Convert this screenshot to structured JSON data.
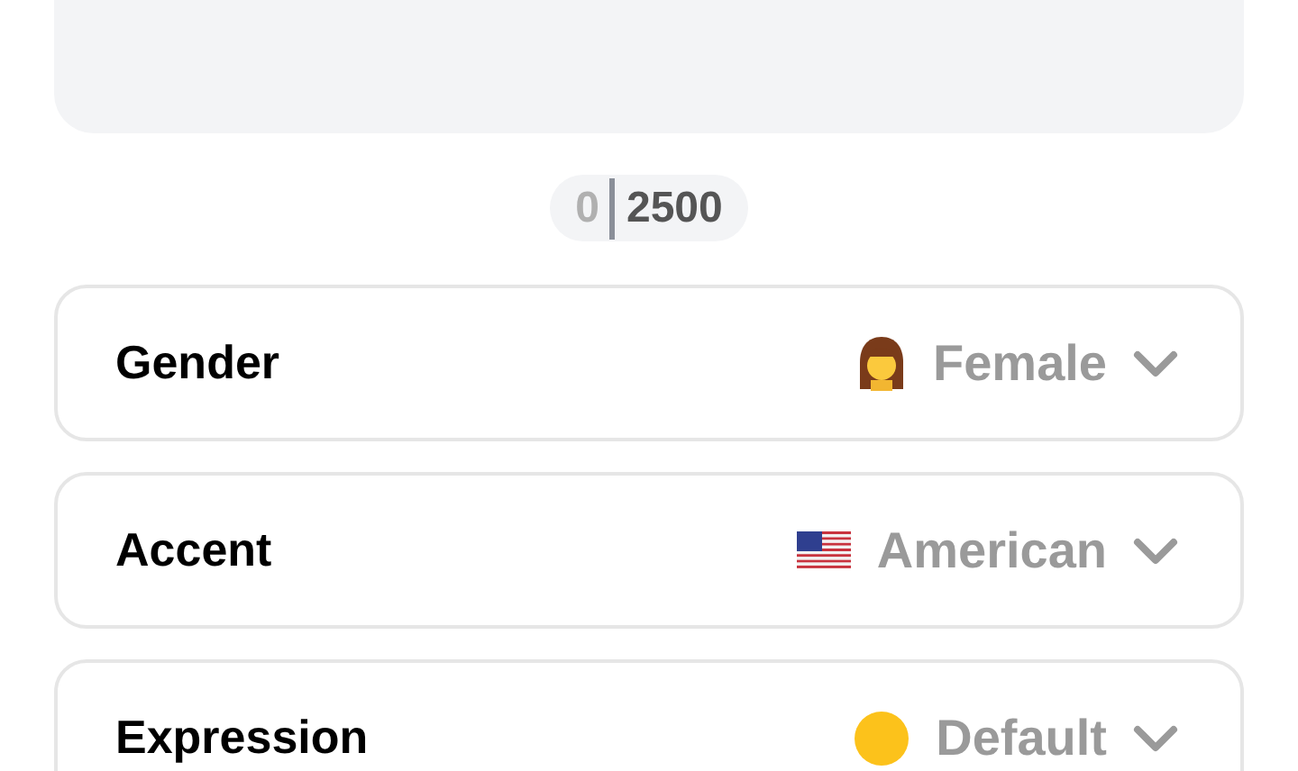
{
  "counter": {
    "current": "0",
    "limit": "2500"
  },
  "settings": [
    {
      "label": "Gender",
      "value": "Female",
      "kind": "person"
    },
    {
      "label": "Accent",
      "value": "American",
      "kind": "flag"
    },
    {
      "label": "Expression",
      "value": "Default",
      "kind": "face"
    }
  ]
}
